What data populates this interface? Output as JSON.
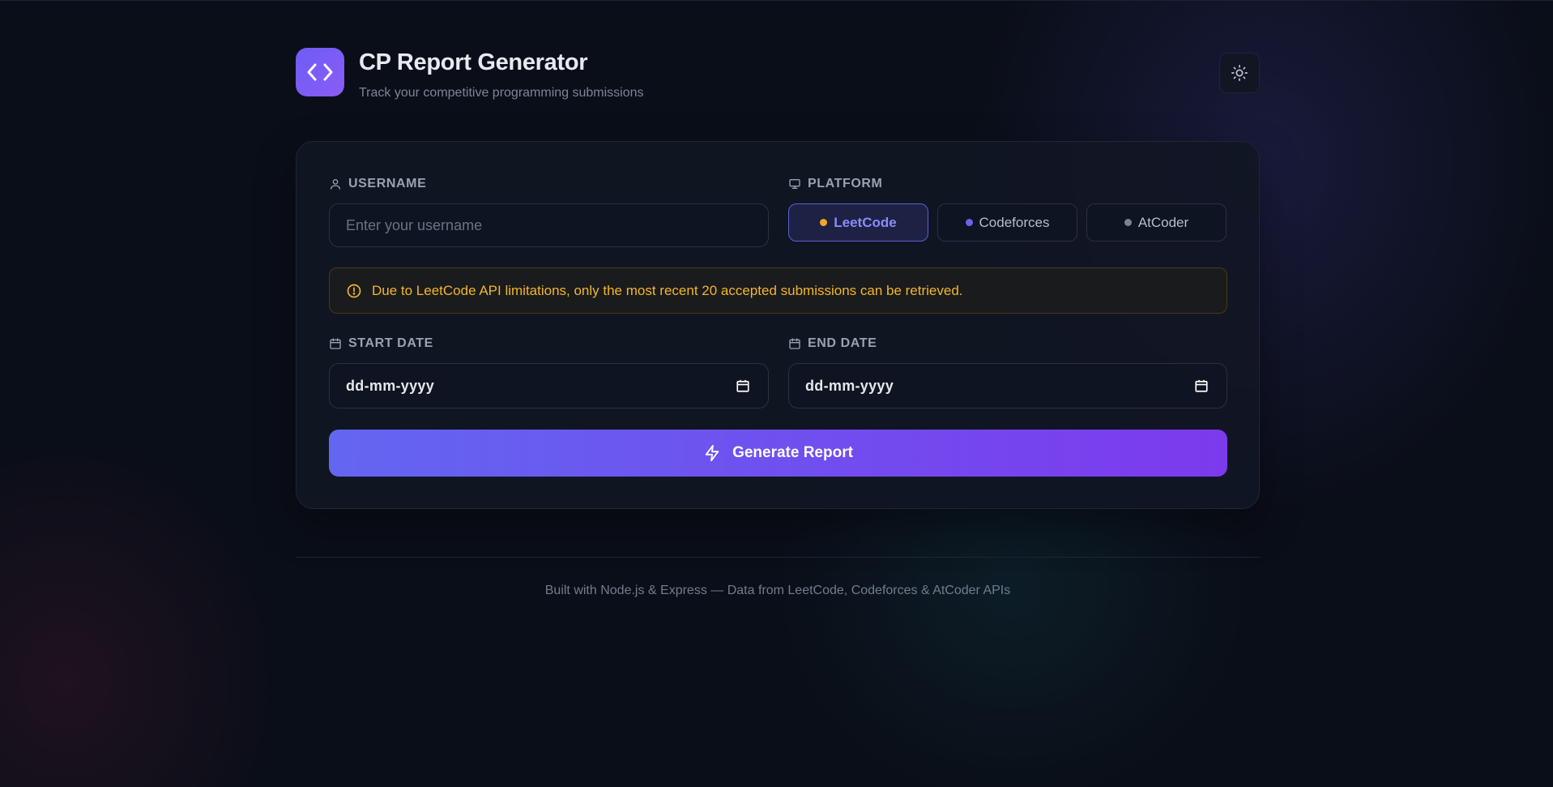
{
  "header": {
    "title": "CP Report Generator",
    "subtitle": "Track your competitive programming submissions",
    "logo_icon": "code-brackets-icon",
    "theme_toggle_icon": "sun-icon"
  },
  "form": {
    "username": {
      "label": "USERNAME",
      "icon": "user-icon",
      "placeholder": "Enter your username",
      "value": ""
    },
    "platform": {
      "label": "PLATFORM",
      "icon": "monitor-icon",
      "selected": "LeetCode",
      "options": [
        {
          "label": "LeetCode",
          "dot_color": "#f5a623"
        },
        {
          "label": "Codeforces",
          "dot_color": "#6c63e8"
        },
        {
          "label": "AtCoder",
          "dot_color": "#7d8290"
        }
      ]
    },
    "warning": {
      "icon": "alert-circle-icon",
      "text": "Due to LeetCode API limitations, only the most recent 20 accepted submissions can be retrieved."
    },
    "start_date": {
      "label": "START DATE",
      "icon": "calendar-icon",
      "placeholder": "dd-mm-yyyy"
    },
    "end_date": {
      "label": "END DATE",
      "icon": "calendar-icon",
      "placeholder": "dd-mm-yyyy"
    },
    "submit": {
      "label": "Generate Report",
      "icon": "lightning-icon"
    }
  },
  "footer": {
    "text": "Built with Node.js & Express — Data from LeetCode, Codeforces & AtCoder APIs"
  },
  "colors": {
    "accent": "#6366f1",
    "accent_secondary": "#7c3aed",
    "warning": "#f3b62a",
    "background": "#0a0e18"
  }
}
